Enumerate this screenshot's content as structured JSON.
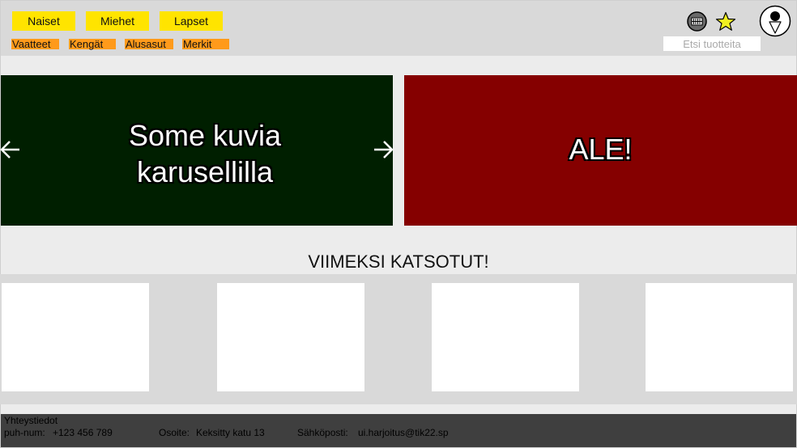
{
  "header": {
    "main_nav": [
      "Naiset",
      "Miehet",
      "Lapset"
    ],
    "sub_nav": [
      "Vaatteet",
      "Kengät",
      "Alusasut",
      "Merkit"
    ],
    "search": {
      "placeholder": "Etsi tuotteita",
      "value": ""
    },
    "icons": [
      "cart-icon",
      "favorites-star-icon",
      "user-profile-icon"
    ]
  },
  "carousel": {
    "text_line1": "Some kuvia",
    "text_line2": "karusellilla",
    "icons": [
      "arrow-left-icon",
      "arrow-right-icon"
    ],
    "background_color": "#001f00"
  },
  "sale": {
    "text": "ALE!",
    "background_color": "#850000"
  },
  "recently_viewed": {
    "title": "VIIMEKSI KATSOTUT!",
    "item_count": 4
  },
  "footer": {
    "heading": "Yhteystiedot",
    "phone_label": "puh-num:",
    "phone": "+123 456 789",
    "address_label": "Osoite:",
    "address": "Keksitty katu 13",
    "email_label": "Sähköposti:",
    "email": "ui.harjoitus@tik22.sp"
  },
  "colors": {
    "main_nav": "#ffe400",
    "sub_nav": "#ff9a1a",
    "header_bg": "#d9d9d9",
    "footer_bg": "#3f3f3f"
  }
}
